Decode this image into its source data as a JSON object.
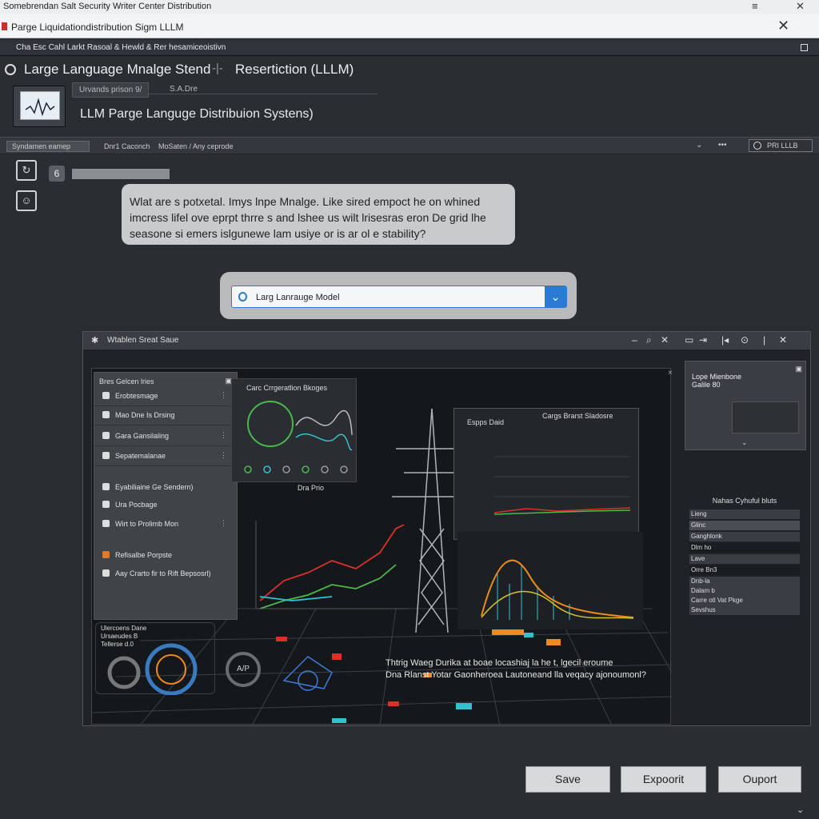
{
  "os_title": "Somebrendan Salt Security Writer Center Distribution",
  "tab": {
    "label": "Parge Liquidationdistribution Sigm LLLM"
  },
  "menu": {
    "label": "Cha Esc Cahl Larkt Rasoal & Hewld & Rer hesamiceoistivn"
  },
  "header": {
    "title_left": "Large Language Mnalge  Stend",
    "title_right": "Resertiction (LLLM)",
    "chip1": "Urvands prison 9/",
    "chip2": "S.A.Dre",
    "subtitle": "LLM Parge Languge Distribuion Systens)"
  },
  "toolbar": {
    "seg1": "Syndamen eamep",
    "item2": "Dnr1 Caconch",
    "item3": "MoSaten / Any ceprode",
    "right_label": "PRI LLLB"
  },
  "chat": {
    "badge": "6",
    "question": "Wlat are s potxetal. Imys lnpe Mnalge. Like sired empoct he on whined imcress lifel ove eprpt thrre s and lshee us wilt lrisesras eron De grid lhe seasone si emers islgunewe lam usiye or is ar ol e stability?",
    "dropdown_value": "Larg Lanrauge Model"
  },
  "inner": {
    "title": "Wtablen Sreat Saue",
    "nav_header": "Bres Gelcen lries",
    "nav_items": [
      "Erobtesmage",
      "Mao Dne Is Drsing",
      "Gara Gansilaling",
      "Sepatemalanae",
      "Eyabiliaine Ge Sendern)",
      "Ura Pocbage",
      "Wirt to Prolimb Mon",
      "Refisalbe Porpste",
      "Aay Crarto fir to Rift Bepsosrl)"
    ],
    "card1_title": "Carc Crrgeratlion Bkoges",
    "card1_axis": "Dra Prio",
    "card_right_title": "Cargs Brarst Sladosre",
    "card_right_label": "Espps Daid",
    "side_card_title": "Lope Mienbone Galile 80",
    "side_list_title": "Nahas Cyhuful bluts",
    "side_list": [
      "Lieng",
      "Glinc",
      "Ganghlonk",
      "Dlm ho",
      "Lave",
      "Orre Bn3",
      "Dnb-la",
      "Dalam b",
      "Carre otl Vat Pkge",
      "Sevshus"
    ],
    "overlay_line1": "Thtrig Waeg Durika at boae locashiaj la he t, lgecil eroume",
    "overlay_line2": "Dna Rlanst Yotar Gaonheroea Lautoneand lla veqacy ajonoumonl?",
    "gauge_labels": [
      "Ulercoens Dane",
      "Ursaeudes B",
      "Tellerse d.0"
    ]
  },
  "buttons": {
    "save": "Save",
    "export": "Expoorit",
    "output": "Ouport"
  },
  "colors": {
    "accent": "#2b7bd3",
    "red": "#d9302a",
    "green": "#4ab84a",
    "orange": "#f08a1f",
    "cyan": "#35c0d0"
  }
}
